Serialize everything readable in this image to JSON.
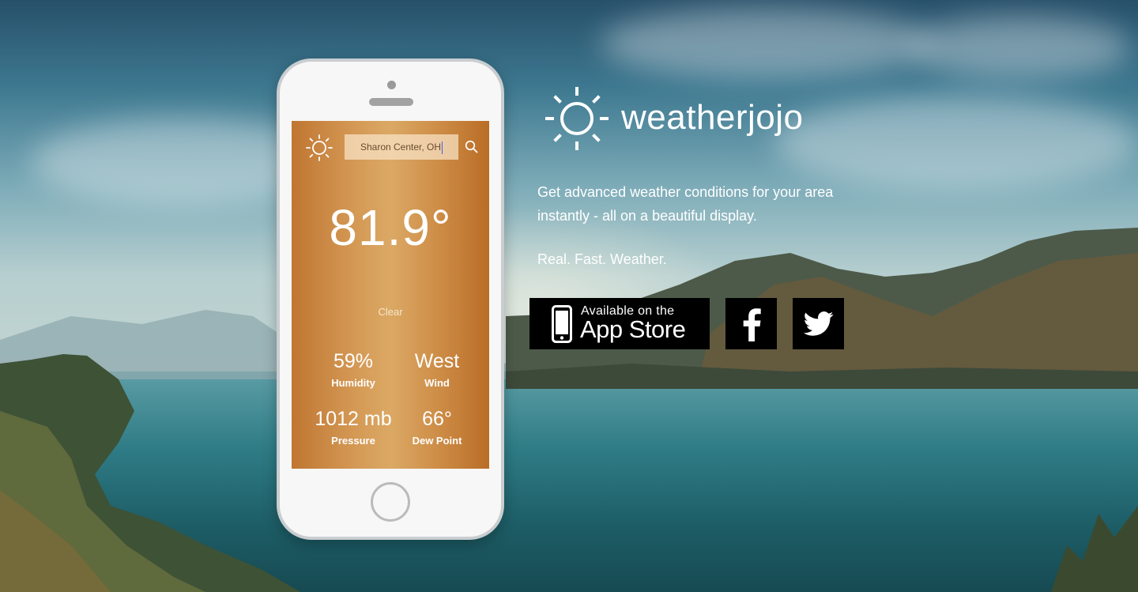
{
  "brand": {
    "name": "weatherjojo",
    "logo_icon": "sun-icon"
  },
  "tagline": "Get advanced weather conditions for your area instantly - all on a beautiful display.",
  "motto": "Real. Fast. Weather.",
  "app_store": {
    "small_label": "Available on the",
    "big_label": "App Store",
    "icon": "phone-icon"
  },
  "social": [
    {
      "name": "facebook",
      "icon": "facebook-icon"
    },
    {
      "name": "twitter",
      "icon": "twitter-icon"
    }
  ],
  "phone": {
    "search": {
      "value": "Sharon Center, OH",
      "icon": "search-icon"
    },
    "temperature": "81.9°",
    "condition": "Clear",
    "stats": [
      {
        "value": "59%",
        "label": "Humidity"
      },
      {
        "value": "West",
        "label": "Wind"
      },
      {
        "value": "1012 mb",
        "label": "Pressure"
      },
      {
        "value": "66°",
        "label": "Dew Point"
      }
    ]
  },
  "colors": {
    "screen_gradient_mid": "#dba965",
    "screen_gradient_edge": "#b96d26",
    "button_bg": "#000000",
    "text": "#ffffff"
  }
}
